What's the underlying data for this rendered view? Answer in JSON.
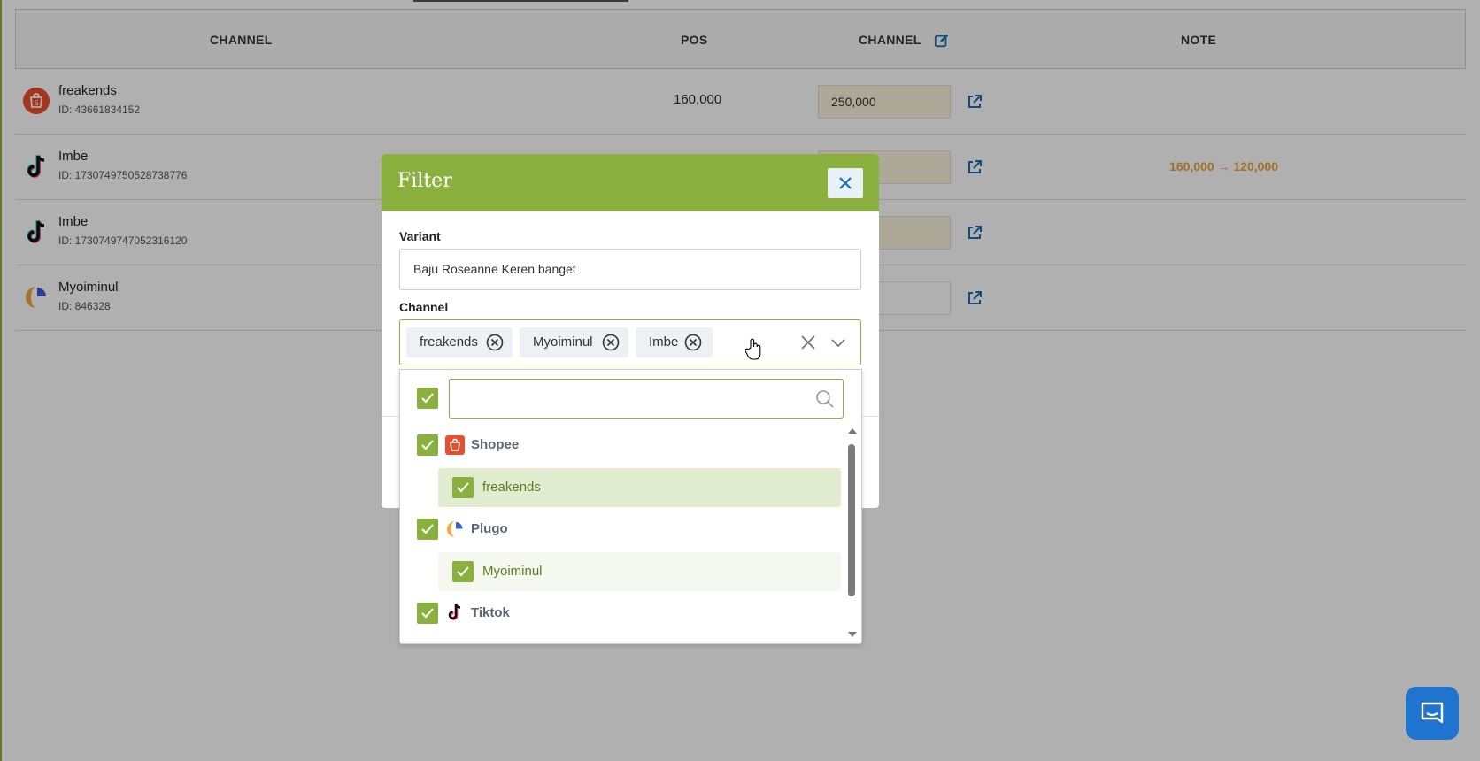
{
  "table": {
    "headers": {
      "channel": "CHANNEL",
      "pos": "POS",
      "channel_price": "CHANNEL",
      "note": "NOTE"
    },
    "rows": [
      {
        "platform": "Shopee",
        "name": "freakends",
        "id": "ID: 43661834152",
        "pos": "160,000",
        "channel_price": "250,000",
        "note": ""
      },
      {
        "platform": "Tiktok",
        "name": "Imbe",
        "id": "ID: 1730749750528738776",
        "pos": "",
        "channel_price": "",
        "note": "160,000 → 120,000"
      },
      {
        "platform": "Tiktok",
        "name": "Imbe",
        "id": "ID: 1730749747052316120",
        "pos": "",
        "channel_price": "",
        "note": ""
      },
      {
        "platform": "Plugo",
        "name": "Myoiminul",
        "id": "ID: 846328",
        "pos": "",
        "channel_price": "",
        "note": ""
      }
    ]
  },
  "modal": {
    "title": "Filter",
    "variant_label": "Variant",
    "variant_value": "Baju Roseanne Keren banget",
    "channel_label": "Channel",
    "selected_chips": [
      "freakends",
      "Myoiminul",
      "Imbe"
    ]
  },
  "dropdown": {
    "search_placeholder": "",
    "select_all_checked": true,
    "groups": [
      {
        "label": "Shopee",
        "checked": true,
        "items": [
          {
            "label": "freakends",
            "checked": true
          }
        ]
      },
      {
        "label": "Plugo",
        "checked": true,
        "items": [
          {
            "label": "Myoiminul",
            "checked": true
          }
        ]
      },
      {
        "label": "Tiktok",
        "checked": true,
        "items": []
      }
    ]
  },
  "colors": {
    "accent": "#8ab13f",
    "note": "#e8a33c",
    "link": "#1a6fb5",
    "chat": "#1f74d0"
  }
}
